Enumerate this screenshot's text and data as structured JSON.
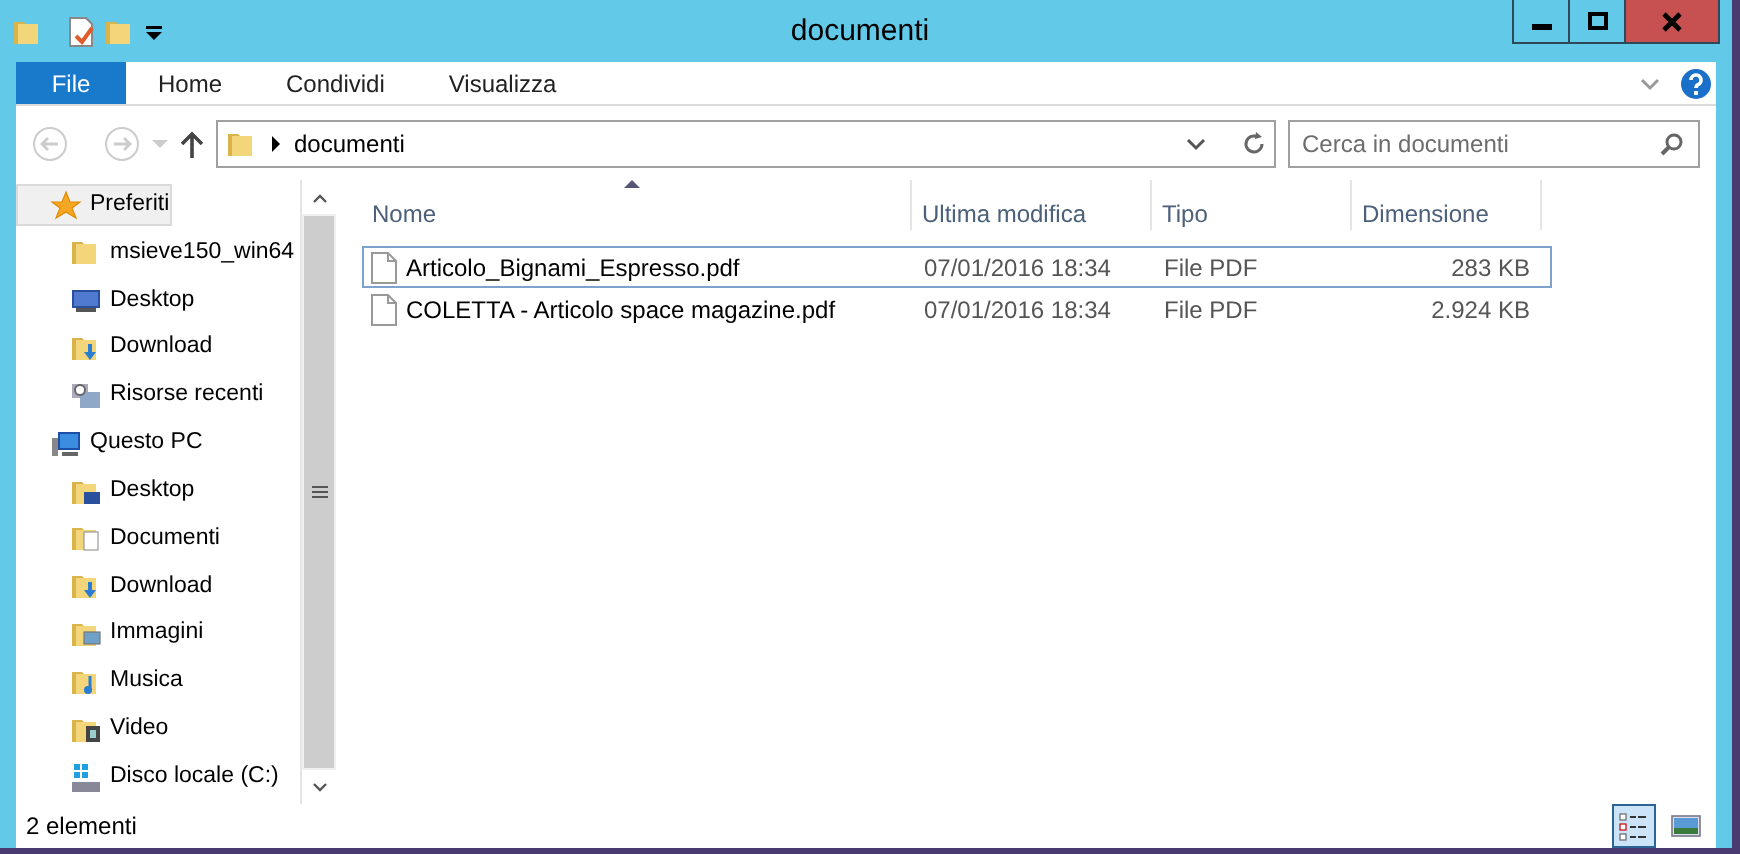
{
  "window": {
    "title": "documenti"
  },
  "ribbon": {
    "tabs": [
      {
        "label": "File",
        "kind": "file"
      },
      {
        "label": "Home",
        "kind": "tab"
      },
      {
        "label": "Condividi",
        "kind": "tab"
      },
      {
        "label": "Visualizza",
        "kind": "tab"
      }
    ]
  },
  "address": {
    "path": "documenti"
  },
  "search": {
    "placeholder": "Cerca in documenti"
  },
  "navigation": [
    {
      "label": "Preferiti",
      "kind": "star",
      "selected": true,
      "children": [
        {
          "label": "msieve150_win64",
          "kind": "folder"
        },
        {
          "label": "Desktop",
          "kind": "monitor"
        },
        {
          "label": "Download",
          "kind": "download"
        },
        {
          "label": "Risorse recenti",
          "kind": "recent"
        }
      ]
    },
    {
      "label": "Questo PC",
      "kind": "pc",
      "selected": false,
      "children": [
        {
          "label": "Desktop",
          "kind": "desktop"
        },
        {
          "label": "Documenti",
          "kind": "documents"
        },
        {
          "label": "Download",
          "kind": "download"
        },
        {
          "label": "Immagini",
          "kind": "pictures"
        },
        {
          "label": "Musica",
          "kind": "music"
        },
        {
          "label": "Video",
          "kind": "video"
        },
        {
          "label": "Disco locale (C:)",
          "kind": "drive"
        }
      ]
    }
  ],
  "table": {
    "columns": [
      "Nome",
      "Ultima modifica",
      "Tipo",
      "Dimensione"
    ],
    "rows": [
      {
        "name": "Articolo_Bignami_Espresso.pdf",
        "modified": "07/01/2016 18:34",
        "type": "File PDF",
        "size": "283 KB",
        "selected": true
      },
      {
        "name": "COLETTA - Articolo space magazine.pdf",
        "modified": "07/01/2016 18:34",
        "type": "File PDF",
        "size": "2.924 KB",
        "selected": false
      }
    ]
  },
  "status_bar": {
    "text": "2 elementi",
    "views": [
      {
        "kind": "details",
        "selected": true
      },
      {
        "kind": "large-icons",
        "selected": false
      }
    ]
  }
}
